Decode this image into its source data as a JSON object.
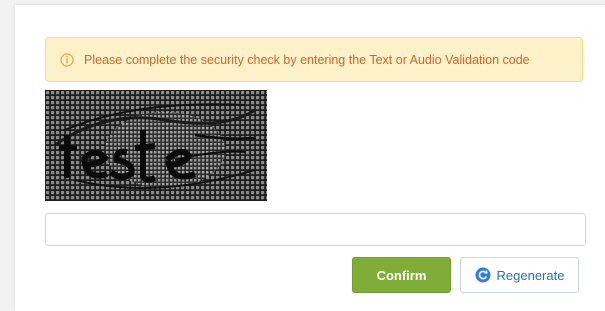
{
  "alert": {
    "icon": "info-circle-icon",
    "message": "Please complete the security check by entering the Text or Audio Validation code",
    "color": "#c9682a",
    "background": "#fcf1c9"
  },
  "captcha": {
    "image_text": "teste"
  },
  "code_input": {
    "value": "",
    "placeholder": ""
  },
  "buttons": {
    "confirm_label": "Confirm",
    "confirm_color": "#7fad37",
    "regenerate_label": "Regenerate",
    "regenerate_icon": "refresh-icon",
    "regenerate_icon_color": "#2f7ed8"
  }
}
